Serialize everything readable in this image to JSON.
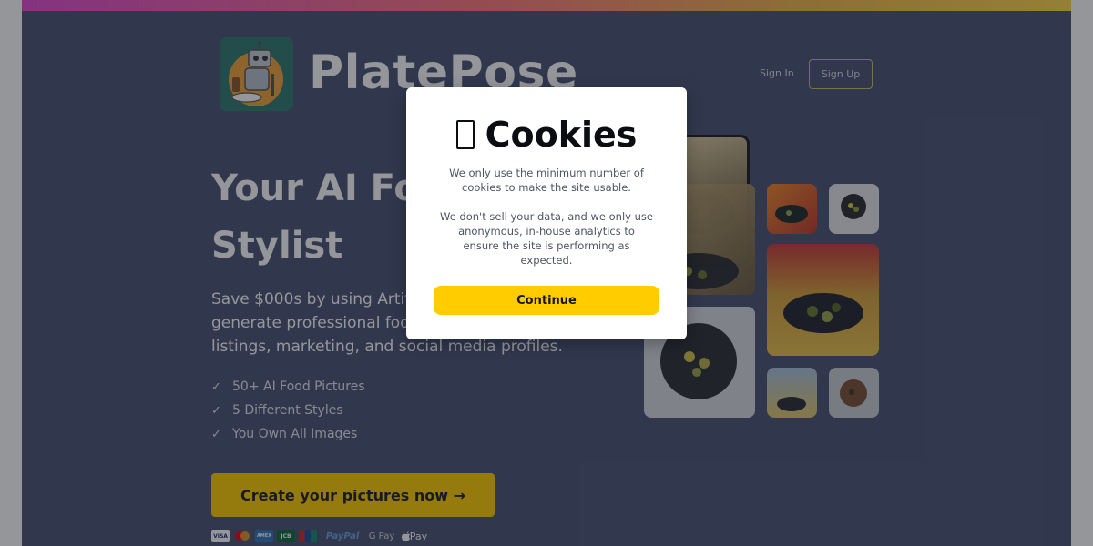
{
  "brand": {
    "name": "PlatePose",
    "logo_icon": "robot-chef-icon"
  },
  "nav": {
    "sign_in": "Sign In",
    "sign_up": "Sign Up"
  },
  "hero": {
    "title_line1": "Your AI Fo",
    "title_line2": "Stylist",
    "subtitle_line1": "Save $000s by using Artific",
    "subtitle_line2": "generate professional food",
    "subtitle_line3": "listings, marketing, and social media profiles."
  },
  "features": [
    {
      "check": "✓",
      "text": "50+ AI Food Pictures"
    },
    {
      "check": "✓",
      "text": "5 Different Styles"
    },
    {
      "check": "✓",
      "text": "You Own All Images"
    }
  ],
  "cta": {
    "label": "Create your pictures now →"
  },
  "payments": [
    "VISA",
    "mastercard",
    "AMEX",
    "JCB",
    "UnionPay",
    "PayPal",
    "G Pay",
    " Pay"
  ],
  "cookie_dialog": {
    "icon": "cookie-icon",
    "title": "Cookies",
    "paragraph1": "We only use the minimum number of cookies to make the site usable.",
    "paragraph2": "We don't sell your data, and we only use anonymous, in-house analytics to ensure the site is performing as expected.",
    "button": "Continue"
  },
  "colors": {
    "accent": "#ffcc00",
    "page_bg": "#4a5575",
    "overlay": "rgba(20,22,30,0.45)"
  }
}
